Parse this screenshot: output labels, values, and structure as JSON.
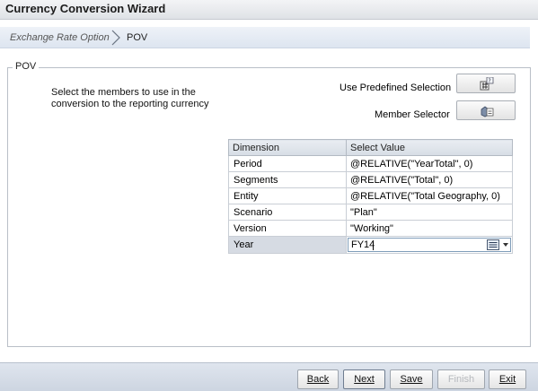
{
  "window": {
    "title": "Currency Conversion Wizard"
  },
  "breadcrumb": {
    "steps": [
      {
        "label": "Exchange Rate Option"
      },
      {
        "label": "POV"
      }
    ]
  },
  "pov": {
    "legend": "POV",
    "instruction": "Select the members to use in the conversion to the reporting currency",
    "use_predefined_label": "Use Predefined Selection",
    "member_selector_label": "Member Selector"
  },
  "grid": {
    "headers": [
      "Dimension",
      "Select Value"
    ],
    "rows": [
      {
        "dimension": "Period",
        "value": "@RELATIVE(\"YearTotal\", 0)"
      },
      {
        "dimension": "Segments",
        "value": "@RELATIVE(\"Total\", 0)"
      },
      {
        "dimension": "Entity",
        "value": "@RELATIVE(\"Total Geography, 0)"
      },
      {
        "dimension": "Scenario",
        "value": "\"Plan\""
      },
      {
        "dimension": "Version",
        "value": "\"Working\""
      },
      {
        "dimension": "Year",
        "value": "FY14"
      }
    ],
    "selected_row": "Year"
  },
  "footer": {
    "back_label": "Back",
    "next_label": "Next",
    "save_label": "Save",
    "finish_label": "Finish",
    "exit_label": "Exit"
  },
  "icons": {
    "predefined_selection": "predefined-selection-icon",
    "member_selector": "member-selector-icon",
    "breadcrumb_separator": "chevron-right-icon",
    "member_picker": "member-picker-icon"
  }
}
